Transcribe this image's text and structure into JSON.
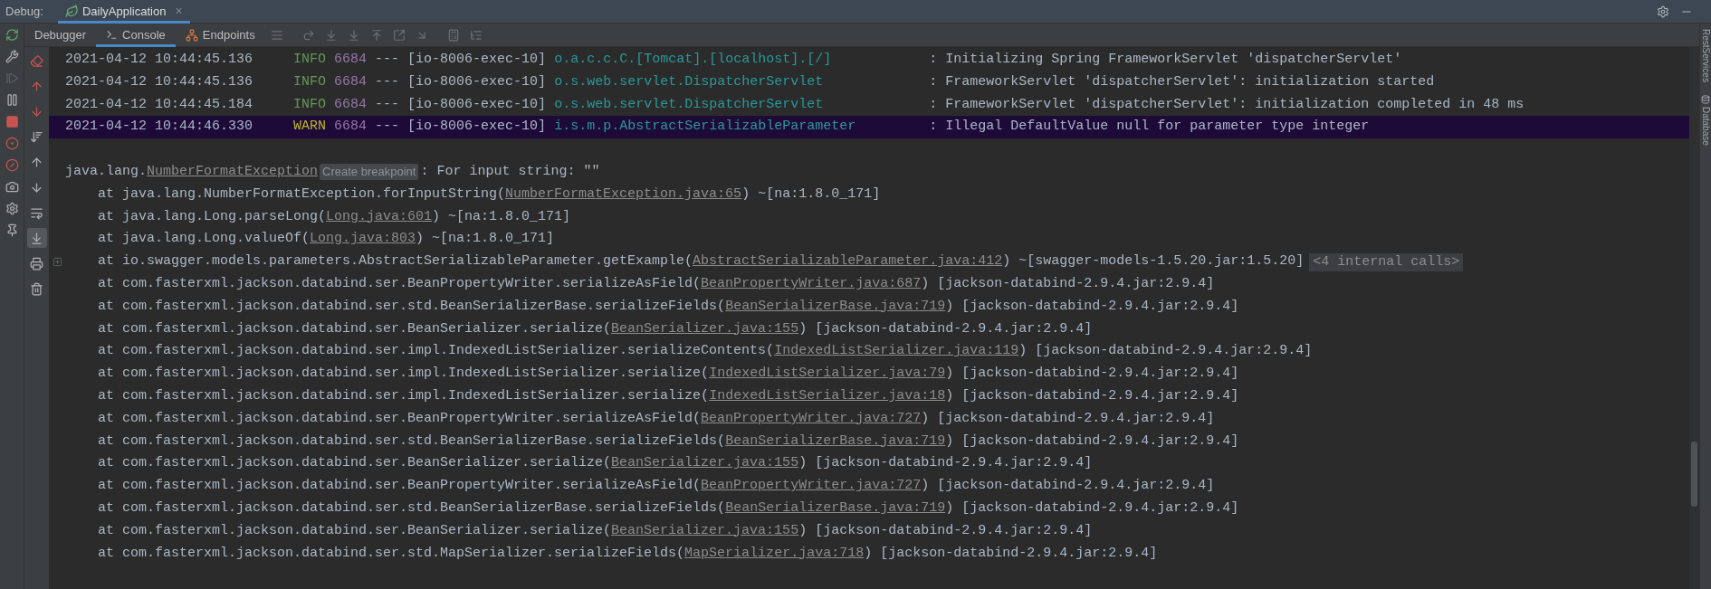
{
  "header": {
    "label": "Debug:",
    "tabs": [
      {
        "title": "DailyApplication",
        "selected": true,
        "close": "×"
      }
    ]
  },
  "toolbar": {
    "tabs": [
      {
        "label": "Debugger",
        "selected": false
      },
      {
        "label": "Console",
        "selected": true
      },
      {
        "label": "Endpoints",
        "selected": false
      }
    ]
  },
  "left_toolbar": [
    {
      "disabled": false
    },
    {
      "disabled": false
    },
    {
      "disabled": true
    },
    {
      "disabled": false
    },
    {
      "disabled": false
    },
    {
      "disabled": false
    },
    {
      "disabled": false
    },
    {
      "disabled": false
    },
    {
      "disabled": false
    },
    {
      "disabled": false
    }
  ],
  "console_toolbar": [
    {
      "selected": false
    },
    {
      "selected": false
    },
    {
      "selected": false
    },
    {
      "selected": false
    },
    {
      "selected": false
    },
    {
      "selected": false
    },
    {
      "selected": false
    },
    {
      "selected": true
    },
    {
      "selected": false
    },
    {
      "selected": false
    }
  ],
  "side_panels": [
    {
      "label": "RestServices"
    },
    {
      "label": "Database"
    }
  ],
  "log_lines": [
    {
      "timestamp": "2021-04-12 10:44:45.136",
      "level": "INFO",
      "kind": "info",
      "pid": "6684",
      "separator": "---",
      "thread": "[io-8006-exec-10]",
      "logger": "o.a.c.c.C.[Tomcat].[localhost].[/]",
      "message": ": Initializing Spring FrameworkServlet 'dispatcherServlet'",
      "highlighted": false
    },
    {
      "timestamp": "2021-04-12 10:44:45.136",
      "level": "INFO",
      "kind": "info",
      "pid": "6684",
      "separator": "---",
      "thread": "[io-8006-exec-10]",
      "logger": "o.s.web.servlet.DispatcherServlet",
      "message": ": FrameworkServlet 'dispatcherServlet': initialization started",
      "highlighted": false
    },
    {
      "timestamp": "2021-04-12 10:44:45.184",
      "level": "INFO",
      "kind": "info",
      "pid": "6684",
      "separator": "---",
      "thread": "[io-8006-exec-10]",
      "logger": "o.s.web.servlet.DispatcherServlet",
      "message": ": FrameworkServlet 'dispatcherServlet': initialization completed in 48 ms",
      "highlighted": false
    },
    {
      "timestamp": "2021-04-12 10:44:46.330",
      "level": "WARN",
      "kind": "warn",
      "pid": "6684",
      "separator": "---",
      "thread": "[io-8006-exec-10]",
      "logger": "i.s.m.p.AbstractSerializableParameter",
      "message": ": Illegal DefaultValue null for parameter type integer",
      "highlighted": true
    }
  ],
  "exception": {
    "prefix": "java.lang.",
    "link": "NumberFormatException",
    "hint": "Create breakpoint",
    "message": ": For input string: \"\""
  },
  "trace": [
    {
      "call": "at java.lang.NumberFormatException.forInputString(",
      "link": "NumberFormatException.java:65",
      "suffix": ") ~[na:1.8.0_171]",
      "foldable": false
    },
    {
      "call": "at java.lang.Long.parseLong(",
      "link": "Long.java:601",
      "suffix": ") ~[na:1.8.0_171]",
      "foldable": false
    },
    {
      "call": "at java.lang.Long.valueOf(",
      "link": "Long.java:803",
      "suffix": ") ~[na:1.8.0_171]",
      "foldable": false
    },
    {
      "call": "at io.swagger.models.parameters.AbstractSerializableParameter.getExample(",
      "link": "AbstractSerializableParameter.java:412",
      "suffix": ") ~[swagger-models-1.5.20.jar:1.5.20]",
      "badge": "<4 internal calls>",
      "foldable": true
    },
    {
      "call": "at com.fasterxml.jackson.databind.ser.BeanPropertyWriter.serializeAsField(",
      "link": "BeanPropertyWriter.java:687",
      "suffix": ") [jackson-databind-2.9.4.jar:2.9.4]",
      "foldable": false
    },
    {
      "call": "at com.fasterxml.jackson.databind.ser.std.BeanSerializerBase.serializeFields(",
      "link": "BeanSerializerBase.java:719",
      "suffix": ") [jackson-databind-2.9.4.jar:2.9.4]",
      "foldable": false
    },
    {
      "call": "at com.fasterxml.jackson.databind.ser.BeanSerializer.serialize(",
      "link": "BeanSerializer.java:155",
      "suffix": ") [jackson-databind-2.9.4.jar:2.9.4]",
      "foldable": false
    },
    {
      "call": "at com.fasterxml.jackson.databind.ser.impl.IndexedListSerializer.serializeContents(",
      "link": "IndexedListSerializer.java:119",
      "suffix": ") [jackson-databind-2.9.4.jar:2.9.4]",
      "foldable": false
    },
    {
      "call": "at com.fasterxml.jackson.databind.ser.impl.IndexedListSerializer.serialize(",
      "link": "IndexedListSerializer.java:79",
      "suffix": ") [jackson-databind-2.9.4.jar:2.9.4]",
      "foldable": false
    },
    {
      "call": "at com.fasterxml.jackson.databind.ser.impl.IndexedListSerializer.serialize(",
      "link": "IndexedListSerializer.java:18",
      "suffix": ") [jackson-databind-2.9.4.jar:2.9.4]",
      "foldable": false
    },
    {
      "call": "at com.fasterxml.jackson.databind.ser.BeanPropertyWriter.serializeAsField(",
      "link": "BeanPropertyWriter.java:727",
      "suffix": ") [jackson-databind-2.9.4.jar:2.9.4]",
      "foldable": false
    },
    {
      "call": "at com.fasterxml.jackson.databind.ser.std.BeanSerializerBase.serializeFields(",
      "link": "BeanSerializerBase.java:719",
      "suffix": ") [jackson-databind-2.9.4.jar:2.9.4]",
      "foldable": false
    },
    {
      "call": "at com.fasterxml.jackson.databind.ser.BeanSerializer.serialize(",
      "link": "BeanSerializer.java:155",
      "suffix": ") [jackson-databind-2.9.4.jar:2.9.4]",
      "foldable": false
    },
    {
      "call": "at com.fasterxml.jackson.databind.ser.BeanPropertyWriter.serializeAsField(",
      "link": "BeanPropertyWriter.java:727",
      "suffix": ") [jackson-databind-2.9.4.jar:2.9.4]",
      "foldable": false
    },
    {
      "call": "at com.fasterxml.jackson.databind.ser.std.BeanSerializerBase.serializeFields(",
      "link": "BeanSerializerBase.java:719",
      "suffix": ") [jackson-databind-2.9.4.jar:2.9.4]",
      "foldable": false
    },
    {
      "call": "at com.fasterxml.jackson.databind.ser.BeanSerializer.serialize(",
      "link": "BeanSerializer.java:155",
      "suffix": ") [jackson-databind-2.9.4.jar:2.9.4]",
      "foldable": false
    },
    {
      "call": "at com.fasterxml.jackson.databind.ser.std.MapSerializer.serializeFields(",
      "link": "MapSerializer.java:718",
      "suffix": ") [jackson-databind-2.9.4.jar:2.9.4]",
      "foldable": false
    }
  ]
}
